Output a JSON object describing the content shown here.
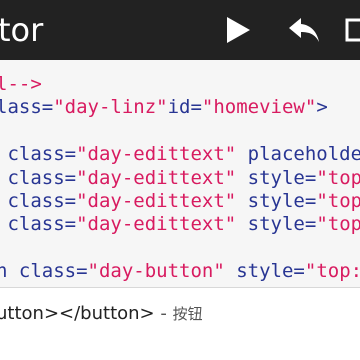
{
  "appbar": {
    "title": "tor",
    "icons": {
      "run": "play-icon",
      "undo": "undo-arrow-icon",
      "more": "more-icon"
    }
  },
  "editor": {
    "lines": [
      {
        "parts": [
          {
            "t": "l-->",
            "c": "comment"
          }
        ]
      },
      {
        "parts": [
          {
            "t": "lass=",
            "c": "attr"
          },
          {
            "t": "\"day-linz\"",
            "c": "str"
          },
          {
            "t": "id=",
            "c": "attr"
          },
          {
            "t": "\"homeview\"",
            "c": "str"
          },
          {
            "t": ">",
            "c": "punc"
          }
        ]
      },
      {
        "parts": [
          {
            "t": "",
            "c": "attr"
          }
        ]
      },
      {
        "parts": [
          {
            "t": " class=",
            "c": "attr"
          },
          {
            "t": "\"day-edittext\"",
            "c": "str"
          },
          {
            "t": " placeholde",
            "c": "attr"
          }
        ]
      },
      {
        "parts": [
          {
            "t": " class=",
            "c": "attr"
          },
          {
            "t": "\"day-edittext\"",
            "c": "str"
          },
          {
            "t": " style=",
            "c": "attr"
          },
          {
            "t": "\"top",
            "c": "str"
          }
        ]
      },
      {
        "parts": [
          {
            "t": " class=",
            "c": "attr"
          },
          {
            "t": "\"day-edittext\"",
            "c": "str"
          },
          {
            "t": " style=",
            "c": "attr"
          },
          {
            "t": "\"top",
            "c": "str"
          }
        ]
      },
      {
        "parts": [
          {
            "t": " class=",
            "c": "attr"
          },
          {
            "t": "\"day-edittext\"",
            "c": "str"
          },
          {
            "t": " style=",
            "c": "attr"
          },
          {
            "t": "\"top",
            "c": "str"
          }
        ]
      },
      {
        "parts": [
          {
            "t": "",
            "c": "attr"
          }
        ]
      },
      {
        "parts": [
          {
            "t": "n class=",
            "c": "attr"
          },
          {
            "t": "\"day-button\"",
            "c": "str"
          },
          {
            "t": " style=",
            "c": "attr"
          },
          {
            "t": "\"top:",
            "c": "str"
          }
        ]
      }
    ]
  },
  "suggestion": {
    "code": "utton></button>",
    "separator": " - ",
    "description": "按钮"
  },
  "colors": {
    "appbar": "#222222",
    "editor_bg": "#f6f6f6",
    "attr": "#283593",
    "string": "#d81b60"
  }
}
